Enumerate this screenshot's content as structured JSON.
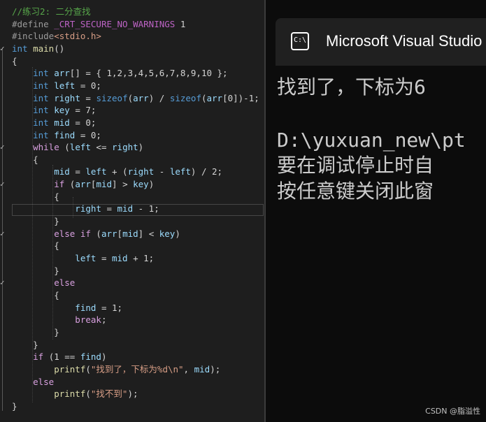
{
  "editor": {
    "lines": [
      {
        "parts": [
          {
            "t": "//练习2: 二分查找",
            "c": "c-com"
          }
        ]
      },
      {
        "parts": [
          {
            "t": "#define ",
            "c": "c-pp"
          },
          {
            "t": "_CRT_SECURE_NO_WARNINGS",
            "c": "c-mac"
          },
          {
            "t": " 1",
            "c": "c-plain"
          }
        ]
      },
      {
        "parts": [
          {
            "t": "#include",
            "c": "c-pp"
          },
          {
            "t": "<stdio.h>",
            "c": "c-str"
          }
        ]
      },
      {
        "parts": [
          {
            "t": "int ",
            "c": "c-kw"
          },
          {
            "t": "main",
            "c": "c-fn"
          },
          {
            "t": "()",
            "c": "c-plain"
          }
        ]
      },
      {
        "parts": [
          {
            "t": "{",
            "c": "c-plain"
          }
        ]
      },
      {
        "parts": [
          {
            "t": "    int ",
            "c": "c-kw"
          },
          {
            "t": "arr",
            "c": "c-var"
          },
          {
            "t": "[] = { 1,2,3,4,5,6,7,8,9,10 };",
            "c": "c-plain"
          }
        ]
      },
      {
        "parts": [
          {
            "t": "    int ",
            "c": "c-kw"
          },
          {
            "t": "left",
            "c": "c-var"
          },
          {
            "t": " = 0;",
            "c": "c-plain"
          }
        ]
      },
      {
        "parts": [
          {
            "t": "    int ",
            "c": "c-kw"
          },
          {
            "t": "right",
            "c": "c-var"
          },
          {
            "t": " = ",
            "c": "c-plain"
          },
          {
            "t": "sizeof",
            "c": "c-kw"
          },
          {
            "t": "(",
            "c": "c-plain"
          },
          {
            "t": "arr",
            "c": "c-var"
          },
          {
            "t": ") / ",
            "c": "c-plain"
          },
          {
            "t": "sizeof",
            "c": "c-kw"
          },
          {
            "t": "(",
            "c": "c-plain"
          },
          {
            "t": "arr",
            "c": "c-var"
          },
          {
            "t": "[0])-1;",
            "c": "c-plain"
          }
        ]
      },
      {
        "parts": [
          {
            "t": "    int ",
            "c": "c-kw"
          },
          {
            "t": "key",
            "c": "c-var"
          },
          {
            "t": " = 7;",
            "c": "c-plain"
          }
        ]
      },
      {
        "parts": [
          {
            "t": "    int ",
            "c": "c-kw"
          },
          {
            "t": "mid",
            "c": "c-var"
          },
          {
            "t": " = 0;",
            "c": "c-plain"
          }
        ]
      },
      {
        "parts": [
          {
            "t": "    int ",
            "c": "c-kw"
          },
          {
            "t": "find",
            "c": "c-var"
          },
          {
            "t": " = 0;",
            "c": "c-plain"
          }
        ]
      },
      {
        "parts": [
          {
            "t": "    while ",
            "c": "c-ctl"
          },
          {
            "t": "(",
            "c": "c-plain"
          },
          {
            "t": "left",
            "c": "c-var"
          },
          {
            "t": " <= ",
            "c": "c-plain"
          },
          {
            "t": "right",
            "c": "c-var"
          },
          {
            "t": ")",
            "c": "c-plain"
          }
        ]
      },
      {
        "parts": [
          {
            "t": "    {",
            "c": "c-plain"
          }
        ]
      },
      {
        "parts": [
          {
            "t": "        mid",
            "c": "c-var"
          },
          {
            "t": " = ",
            "c": "c-plain"
          },
          {
            "t": "left",
            "c": "c-var"
          },
          {
            "t": " + (",
            "c": "c-plain"
          },
          {
            "t": "right",
            "c": "c-var"
          },
          {
            "t": " - ",
            "c": "c-plain"
          },
          {
            "t": "left",
            "c": "c-var"
          },
          {
            "t": ") / 2;",
            "c": "c-plain"
          }
        ]
      },
      {
        "parts": [
          {
            "t": "        if ",
            "c": "c-ctl"
          },
          {
            "t": "(",
            "c": "c-plain"
          },
          {
            "t": "arr",
            "c": "c-var"
          },
          {
            "t": "[",
            "c": "c-plain"
          },
          {
            "t": "mid",
            "c": "c-var"
          },
          {
            "t": "] > ",
            "c": "c-plain"
          },
          {
            "t": "key",
            "c": "c-var"
          },
          {
            "t": ")",
            "c": "c-plain"
          }
        ]
      },
      {
        "parts": [
          {
            "t": "        {",
            "c": "c-plain"
          }
        ]
      },
      {
        "parts": [
          {
            "t": "            right",
            "c": "c-var"
          },
          {
            "t": " = ",
            "c": "c-plain"
          },
          {
            "t": "mid",
            "c": "c-var"
          },
          {
            "t": " - 1;",
            "c": "c-plain"
          }
        ]
      },
      {
        "parts": [
          {
            "t": "        }",
            "c": "c-plain"
          }
        ]
      },
      {
        "parts": [
          {
            "t": "        else if ",
            "c": "c-ctl"
          },
          {
            "t": "(",
            "c": "c-plain"
          },
          {
            "t": "arr",
            "c": "c-var"
          },
          {
            "t": "[",
            "c": "c-plain"
          },
          {
            "t": "mid",
            "c": "c-var"
          },
          {
            "t": "] < ",
            "c": "c-plain"
          },
          {
            "t": "key",
            "c": "c-var"
          },
          {
            "t": ")",
            "c": "c-plain"
          }
        ]
      },
      {
        "parts": [
          {
            "t": "        {",
            "c": "c-plain"
          }
        ]
      },
      {
        "parts": [
          {
            "t": "            left",
            "c": "c-var"
          },
          {
            "t": " = ",
            "c": "c-plain"
          },
          {
            "t": "mid",
            "c": "c-var"
          },
          {
            "t": " + 1;",
            "c": "c-plain"
          }
        ]
      },
      {
        "parts": [
          {
            "t": "        }",
            "c": "c-plain"
          }
        ]
      },
      {
        "parts": [
          {
            "t": "        else",
            "c": "c-ctl"
          }
        ]
      },
      {
        "parts": [
          {
            "t": "        {",
            "c": "c-plain"
          }
        ]
      },
      {
        "parts": [
          {
            "t": "            find",
            "c": "c-var"
          },
          {
            "t": " = 1;",
            "c": "c-plain"
          }
        ]
      },
      {
        "parts": [
          {
            "t": "            break",
            "c": "c-ctl"
          },
          {
            "t": ";",
            "c": "c-plain"
          }
        ]
      },
      {
        "parts": [
          {
            "t": "        }",
            "c": "c-plain"
          }
        ]
      },
      {
        "parts": [
          {
            "t": "    }",
            "c": "c-plain"
          }
        ]
      },
      {
        "parts": [
          {
            "t": "    if ",
            "c": "c-ctl"
          },
          {
            "t": "(1 == ",
            "c": "c-plain"
          },
          {
            "t": "find",
            "c": "c-var"
          },
          {
            "t": ")",
            "c": "c-plain"
          }
        ]
      },
      {
        "parts": [
          {
            "t": "        printf",
            "c": "c-fn"
          },
          {
            "t": "(",
            "c": "c-plain"
          },
          {
            "t": "\"找到了，下标为%d\\n\"",
            "c": "c-str"
          },
          {
            "t": ", ",
            "c": "c-plain"
          },
          {
            "t": "mid",
            "c": "c-var"
          },
          {
            "t": ");",
            "c": "c-plain"
          }
        ]
      },
      {
        "parts": [
          {
            "t": "    else",
            "c": "c-ctl"
          }
        ]
      },
      {
        "parts": [
          {
            "t": "        printf",
            "c": "c-fn"
          },
          {
            "t": "(",
            "c": "c-plain"
          },
          {
            "t": "\"找不到\"",
            "c": "c-str"
          },
          {
            "t": ");",
            "c": "c-plain"
          }
        ]
      },
      {
        "parts": [
          {
            "t": "}",
            "c": "c-plain"
          }
        ]
      }
    ]
  },
  "console": {
    "title": "Microsoft Visual Studio",
    "icon_text": "C:\\",
    "lines": [
      "找到了，下标为6",
      "",
      "D:\\yuxuan_new\\pt",
      "要在调试停止时自",
      "按任意键关闭此窗"
    ]
  },
  "watermark": "CSDN @脂溢性"
}
